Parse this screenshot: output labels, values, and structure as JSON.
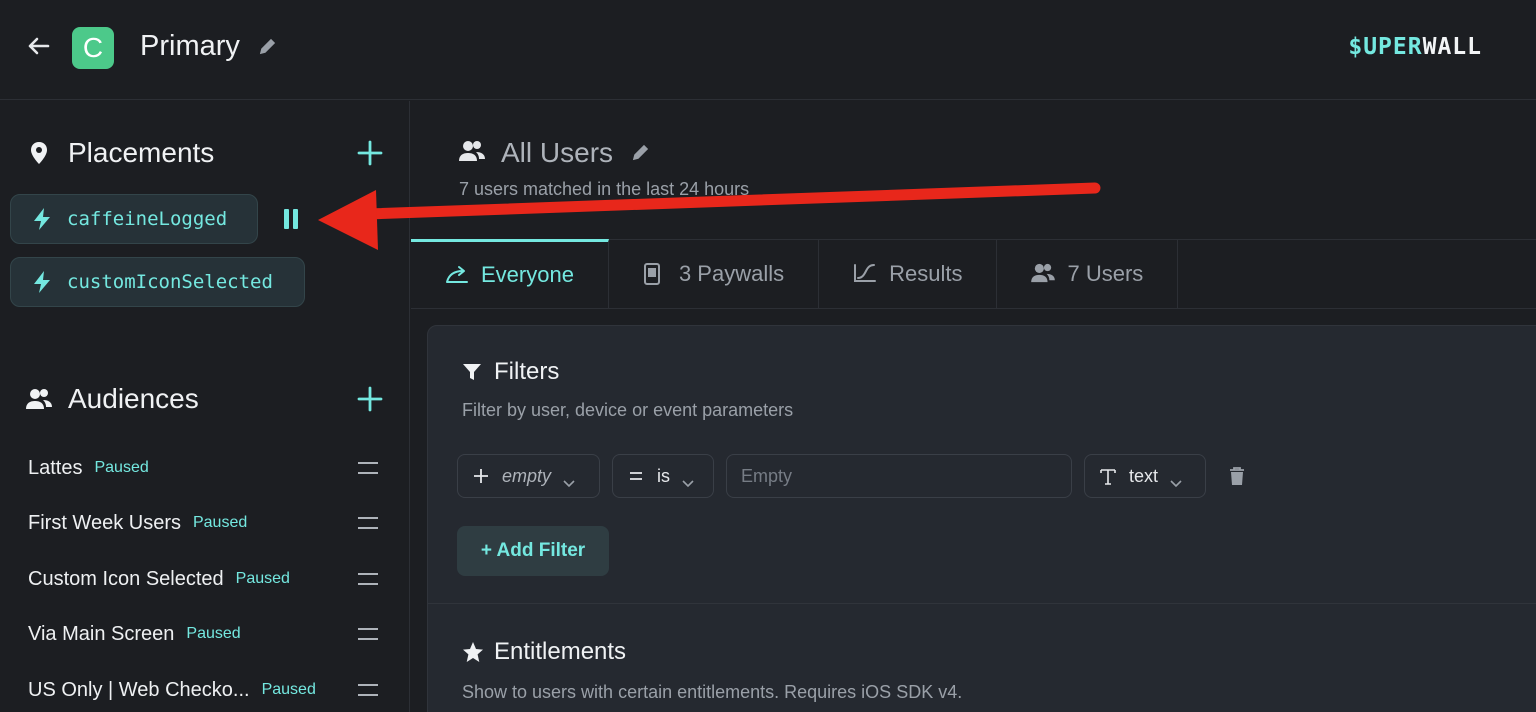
{
  "header": {
    "app_initial": "C",
    "app_name": "Primary",
    "brand_accent": "$UPER",
    "brand_rest": "WALL"
  },
  "sidebar": {
    "placements_title": "Placements",
    "placements": [
      {
        "label": "caffeineLogged"
      },
      {
        "label": "customIconSelected"
      }
    ],
    "audiences_title": "Audiences",
    "audiences": [
      {
        "name": "Lattes",
        "status": "Paused"
      },
      {
        "name": "First Week Users",
        "status": "Paused"
      },
      {
        "name": "Custom Icon Selected",
        "status": "Paused"
      },
      {
        "name": "Via Main Screen",
        "status": "Paused"
      },
      {
        "name": "US Only | Web Checko...",
        "status": "Paused"
      }
    ]
  },
  "main": {
    "audience_title": "All Users",
    "audience_subtitle": "7 users matched in the last 24 hours",
    "tabs": [
      {
        "label": "Everyone"
      },
      {
        "label": "3 Paywalls"
      },
      {
        "label": "Results"
      },
      {
        "label": "7 Users"
      }
    ],
    "filters": {
      "title": "Filters",
      "subtitle": "Filter by user, device or event parameters",
      "field_value": "empty",
      "operator_value": "is",
      "input_placeholder": "Empty",
      "type_value": "text",
      "add_button": "+ Add Filter"
    },
    "entitlements": {
      "title": "Entitlements",
      "subtitle": "Show to users with certain entitlements. Requires iOS SDK v4."
    }
  },
  "colors": {
    "accent": "#74e8e0",
    "badge": "#4cc98a",
    "annotation_arrow": "#e8271b"
  }
}
